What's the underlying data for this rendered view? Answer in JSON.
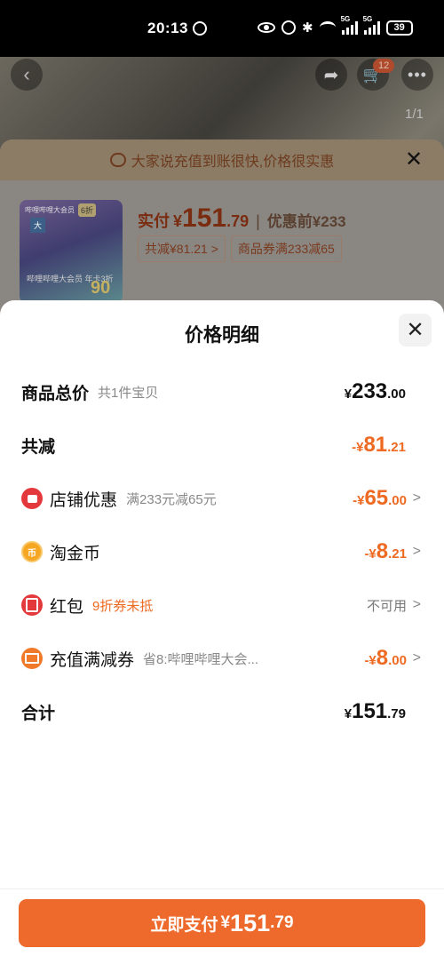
{
  "status_bar": {
    "time": "20:13",
    "battery": "39",
    "net1": "5G",
    "net2": "5G"
  },
  "background_page": {
    "back_icon": "back-arrow-icon",
    "share_icon": "share-icon",
    "cart_icon": "cart-icon",
    "cart_badge": "12",
    "more_icon": "more-icon",
    "image_counter": "1/1"
  },
  "behind_panel": {
    "banner_text": "大家说充值到账很快,价格很实惠",
    "pay_label": "实付",
    "pay_currency": "¥",
    "pay_integer": "151",
    "pay_decimal": ".79",
    "pre_discount": "优惠前¥233",
    "tag_total_reduce": "共减¥81.21 >",
    "tag_coupon": "商品券满233减65",
    "thumb_text_1": "哔哩哔哩大会员",
    "thumb_text_2": "6折",
    "thumb_text_3": "大",
    "thumb_text_4": "哔哩哔哩大会员\n年卡3折",
    "thumb_text_5": "90"
  },
  "sheet": {
    "title": "价格明细",
    "close_icon": "close-icon",
    "rows": {
      "total": {
        "label": "商品总价",
        "sub": "共1件宝贝",
        "sign": "¥",
        "integer": "233",
        "decimal": ".00"
      },
      "reduce": {
        "label": "共减",
        "sign": "-¥",
        "integer": "81",
        "decimal": ".21"
      },
      "shop": {
        "label": "店铺优惠",
        "sub": "满233元减65元",
        "sign": "-¥",
        "integer": "65",
        "decimal": ".00"
      },
      "coin": {
        "label": "淘金币",
        "sign": "-¥",
        "integer": "8",
        "decimal": ".21"
      },
      "redpack": {
        "label": "红包",
        "sub": "9折券未抵",
        "value": "不可用"
      },
      "recharge": {
        "label": "充值满减券",
        "sub": "省8:哔哩哔哩大会...",
        "sign": "-¥",
        "integer": "8",
        "decimal": ".00"
      },
      "sum": {
        "label": "合计",
        "sign": "¥",
        "integer": "151",
        "decimal": ".79"
      }
    },
    "arrow": ">",
    "colors": {
      "accent": "#ee6a22",
      "button": "#ee6a2c"
    }
  },
  "pay_button": {
    "label": "立即支付",
    "sign": "¥",
    "integer": "151",
    "decimal": ".79"
  }
}
